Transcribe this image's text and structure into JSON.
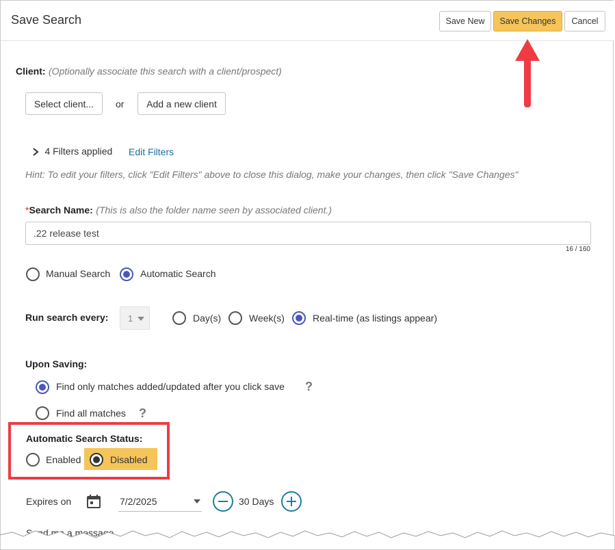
{
  "header": {
    "title": "Save Search",
    "save_new_label": "Save New",
    "save_changes_label": "Save Changes",
    "cancel_label": "Cancel"
  },
  "client": {
    "label": "Client:",
    "hint": "(Optionally associate this search with a client/prospect)",
    "select_button": "Select client...",
    "or_text": "or",
    "add_button": "Add a new client"
  },
  "filters": {
    "applied_text": "4 Filters applied",
    "edit_link": "Edit Filters",
    "hint": "Hint: To edit your filters, click \"Edit Filters\" above to close this dialog, make your changes, then click \"Save Changes\""
  },
  "search_name": {
    "required_mark": "*",
    "label": "Search Name:",
    "hint": "(This is also the folder name seen by associated client.)",
    "value": ".22 release test",
    "counter": "16 / 160"
  },
  "search_type": {
    "options": [
      "Manual Search",
      "Automatic Search"
    ],
    "selected": "Automatic Search"
  },
  "run_every": {
    "label": "Run search every:",
    "number_value": "1",
    "options": [
      "Day(s)",
      "Week(s)",
      "Real-time (as listings appear)"
    ],
    "selected": "Real-time (as listings appear)"
  },
  "upon_saving": {
    "label": "Upon Saving:",
    "options": [
      "Find only matches added/updated after you click save",
      "Find all matches"
    ],
    "selected": "Find only matches added/updated after you click save",
    "help_mark": "?"
  },
  "status": {
    "label": "Automatic Search Status:",
    "options": [
      "Enabled",
      "Disabled"
    ],
    "selected": "Disabled"
  },
  "expires": {
    "label": "Expires on",
    "date_value": "7/2/2025",
    "days_text": "30 Days"
  },
  "message": {
    "label": "Send me a message"
  },
  "colors": {
    "accent_yellow": "#f5c55a",
    "radio_blue": "#4a57b8",
    "annotation_red": "#ee3b44",
    "link_blue": "#1a6fa0",
    "teal": "#1a7ea0"
  }
}
